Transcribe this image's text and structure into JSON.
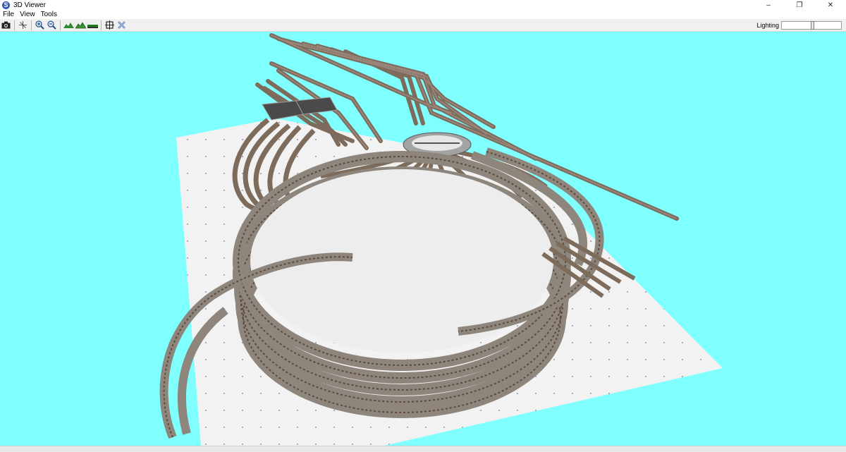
{
  "window": {
    "title": "3D Viewer",
    "app_icon": "S"
  },
  "window_controls": {
    "minimize": "–",
    "restore": "❐",
    "close": "✕"
  },
  "menu": {
    "items": [
      {
        "label": "File"
      },
      {
        "label": "View"
      },
      {
        "label": "Tools"
      }
    ]
  },
  "toolbar": {
    "buttons": [
      "camera-icon",
      "axes-icon",
      "zoom-in-icon",
      "zoom-out-icon",
      "terrain-icon",
      "terrain-mesh-icon",
      "baseboard-icon",
      "fit-view-icon",
      "close-view-icon"
    ],
    "lighting": {
      "label": "Lighting",
      "level": 0.52
    }
  },
  "colors": {
    "sky": "#80ffff",
    "baseboard": "#f2f2f2",
    "ballast": "#9a9288",
    "rail": "#6b4b34",
    "turntable": "#a3a3a3"
  }
}
